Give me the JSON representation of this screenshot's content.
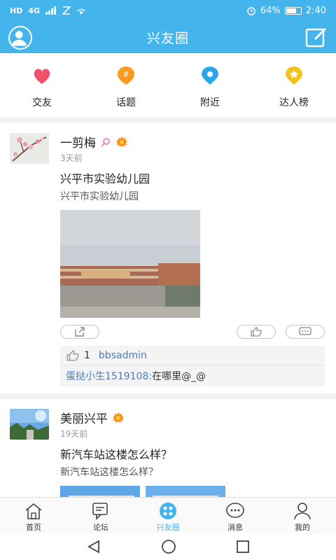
{
  "status": {
    "left_icons": [
      "HD",
      "4G",
      "signal",
      "nfc",
      "hotspot"
    ],
    "battery": "64%",
    "time": "2:40",
    "alarm_icon": "alarm-icon"
  },
  "header": {
    "title": "兴友圈"
  },
  "quick_nav": [
    {
      "label": "交友",
      "icon": "heart-icon",
      "color": "#f2506b"
    },
    {
      "label": "话题",
      "icon": "hashtag-icon",
      "color": "#ff9a1f"
    },
    {
      "label": "附近",
      "icon": "location-icon",
      "color": "#2aa7e8"
    },
    {
      "label": "达人榜",
      "icon": "medal-icon",
      "color": "#f5c11a"
    }
  ],
  "posts": [
    {
      "author": "一剪梅",
      "time": "3天前",
      "title": "兴平市实验幼儿园",
      "summary": "兴平市实验幼儿园",
      "likes": {
        "count": "1",
        "users": "bbsadmin"
      },
      "comment": {
        "user": "蛋挞小生1519108:",
        "text": " 在哪里@_@"
      }
    },
    {
      "author": "美丽兴平",
      "time": "19天前",
      "title": "新汽车站这楼怎么样？",
      "summary": "新汽车站这楼怎么样？"
    }
  ],
  "tabs": [
    {
      "label": "首页",
      "icon": "home-icon"
    },
    {
      "label": "论坛",
      "icon": "forum-icon"
    },
    {
      "label": "兴友圈",
      "icon": "circle-icon",
      "active": true
    },
    {
      "label": "消息",
      "icon": "message-icon"
    },
    {
      "label": "我的",
      "icon": "profile-icon"
    }
  ],
  "colors": {
    "primary": "#44b4ec",
    "link": "#4d7cba"
  }
}
